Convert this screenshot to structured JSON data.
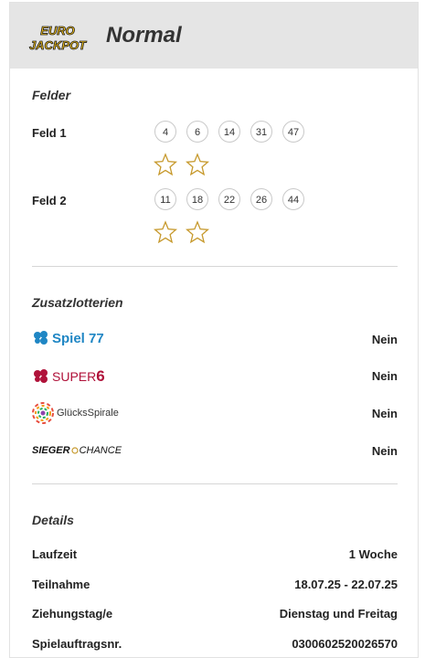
{
  "header": {
    "logo_top": "EURO",
    "logo_bottom": "JACKPOT",
    "title": "Normal"
  },
  "felder": {
    "heading": "Felder",
    "rows": [
      {
        "label": "Feld 1",
        "numbers": [
          "4",
          "6",
          "14",
          "31",
          "47"
        ],
        "stars": 2
      },
      {
        "label": "Feld 2",
        "numbers": [
          "11",
          "18",
          "22",
          "26",
          "44"
        ],
        "stars": 2
      }
    ]
  },
  "zusatz": {
    "heading": "Zusatzlotterien",
    "items": [
      {
        "brand": "Spiel 77",
        "value": "Nein",
        "color": "#1f86c4"
      },
      {
        "brand_a": "SUPER",
        "brand_b": "6",
        "value": "Nein",
        "color": "#b0123a"
      },
      {
        "brand": "GlücksSpirale",
        "value": "Nein"
      },
      {
        "brand_a": "SIEGER",
        "brand_b": "CHANCE",
        "value": "Nein"
      }
    ]
  },
  "details": {
    "heading": "Details",
    "rows": [
      {
        "label": "Laufzeit",
        "value": "1 Woche"
      },
      {
        "label": "Teilnahme",
        "value": "18.07.25 - 22.07.25"
      },
      {
        "label": "Ziehungstag/e",
        "value": "Dienstag und Freitag"
      },
      {
        "label": "Spielauftragsnr.",
        "value": "0300602520026570"
      }
    ]
  },
  "colors": {
    "star": "#c79a2e",
    "logo_yellow": "#f5c21a",
    "logo_dark": "#1a1a1a"
  }
}
